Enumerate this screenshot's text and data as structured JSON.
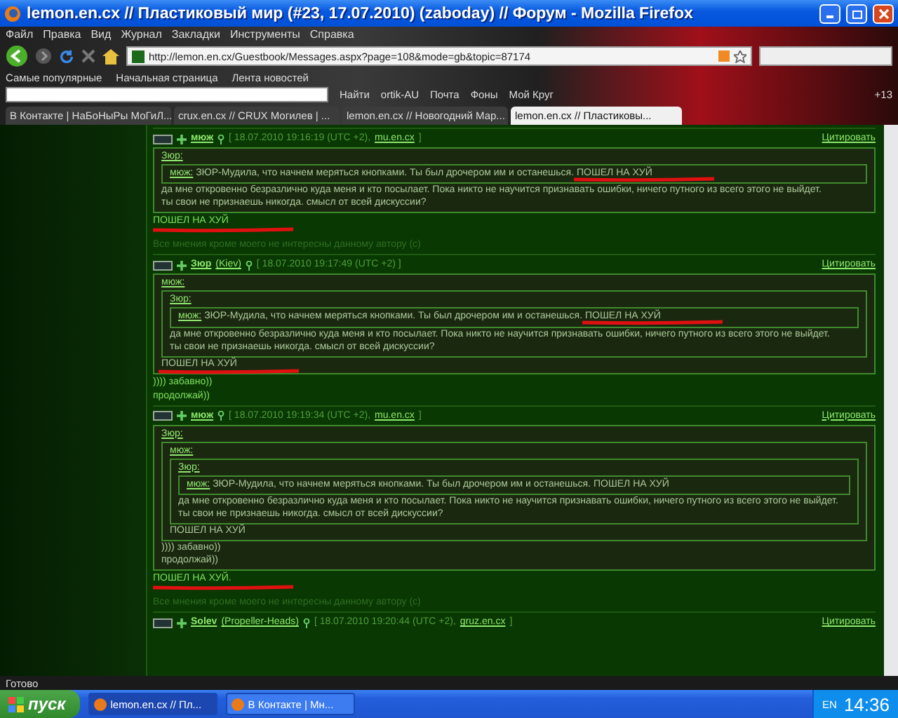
{
  "window": {
    "title": "lemon.en.cx // Пластиковый мир (#23, 17.07.2010) (zaboday) // Форум - Mozilla Firefox"
  },
  "menu": [
    "Файл",
    "Правка",
    "Вид",
    "Журнал",
    "Закладки",
    "Инструменты",
    "Справка"
  ],
  "address": {
    "value": "http://lemon.en.cx/Guestbook/Messages.aspx?page=108&mode=gb&topic=87174"
  },
  "bookmarks": [
    "Самые популярные",
    "Начальная страница",
    "Лента новостей"
  ],
  "yandex_bar": {
    "find_button": "Найти",
    "items": [
      "ortik-AU",
      "Почта",
      "Фоны",
      "Мой Круг"
    ],
    "counter": "+13"
  },
  "tabs": [
    {
      "label": "В Контакте | НаБоНыРы МоГиЛ...",
      "selected": false
    },
    {
      "label": "crux.en.cx // CRUX Могилев | ...",
      "selected": false
    },
    {
      "label": "lemon.en.cx // Новогодний Мар...",
      "selected": false
    },
    {
      "label": "lemon.en.cx // Пластиковы...",
      "selected": true
    }
  ],
  "posts": [
    {
      "author": "мюж",
      "date": "[ 18.07.2010 19:16:19 (UTC +2),",
      "link": "mu.en.cx",
      "bracket": "]",
      "quote_action": "Цитировать",
      "quote": {
        "kind": "block",
        "author": "Зюр:",
        "quote": {
          "kind": "inline",
          "author": "мюж:",
          "text": "ЗЮР-Мудила, что начнем меряться кнопками. Ты был дрочером им и останешься.",
          "highlight": {
            "text": "ПОШЕЛ НА ХУЙ",
            "annotated": true
          }
        },
        "lines": [
          {
            "text": "да мне откровенно безразлично куда меня и кто посылает. Пока никто не научится признавать ошибки, ничего путного из всего этого не выйдет.",
            "annotated": false
          },
          {
            "text": "ты свои не признаешь никогда. смысл от всей дискуссии?",
            "annotated": false
          }
        ]
      },
      "reply": [
        {
          "text": "ПОШЕЛ НА ХУЙ",
          "annotated": true
        }
      ],
      "signature": "Все мнения кроме моего не интересны данному автору (с)"
    },
    {
      "author": "Зюр",
      "city": "(Kiev)",
      "date": "[ 18.07.2010 19:17:49 (UTC +2) ]",
      "quote_action": "Цитировать",
      "quote": {
        "kind": "block",
        "author": "мюж:",
        "quote": {
          "kind": "block",
          "author": "Зюр:",
          "quote": {
            "kind": "inline",
            "author": "мюж:",
            "text": "ЗЮР-Мудила, что начнем меряться кнопками. Ты был дрочером им и останешься.",
            "highlight": {
              "text": "ПОШЕЛ НА ХУЙ",
              "annotated": true
            }
          },
          "lines": [
            {
              "text": "да мне откровенно безразлично куда меня и кто посылает. Пока никто не научится признавать ошибки, ничего путного из всего этого не выйдет.",
              "annotated": false
            },
            {
              "text": "ты свои не признаешь никогда. смысл от всей дискуссии?",
              "annotated": false
            }
          ]
        },
        "lines": [
          {
            "text": "ПОШЕЛ НА ХУЙ",
            "annotated": true
          }
        ]
      },
      "reply": [
        {
          "text": ")))) забавно))",
          "annotated": false
        },
        {
          "text": "продолжай))",
          "annotated": false
        }
      ]
    },
    {
      "author": "мюж",
      "date": "[ 18.07.2010 19:19:34 (UTC +2),",
      "link": "mu.en.cx",
      "bracket": "]",
      "quote_action": "Цитировать",
      "quote": {
        "kind": "block",
        "author": "Зюр:",
        "quote": {
          "kind": "block",
          "author": "мюж:",
          "quote": {
            "kind": "block",
            "author": "Зюр:",
            "quote": {
              "kind": "inline",
              "author": "мюж:",
              "text": "ЗЮР-Мудила, что начнем меряться кнопками. Ты был дрочером им и останешься.",
              "highlight": {
                "text": "ПОШЕЛ НА ХУЙ",
                "annotated": false
              }
            },
            "lines": [
              {
                "text": "да мне откровенно безразлично куда меня и кто посылает. Пока никто не научится признавать ошибки, ничего путного из всего этого не выйдет.",
                "annotated": false
              },
              {
                "text": "ты свои не признаешь никогда. смысл от всей дискуссии?",
                "annotated": false
              }
            ]
          },
          "lines": [
            {
              "text": "ПОШЕЛ НА ХУЙ",
              "annotated": false
            }
          ]
        },
        "lines": [
          {
            "text": ")))) забавно))",
            "annotated": false
          },
          {
            "text": "продолжай))",
            "annotated": false
          }
        ]
      },
      "reply": [
        {
          "text": "ПОШЕЛ НА ХУЙ.",
          "annotated": true
        }
      ],
      "signature": "Все мнения кроме моего не интересны данному автору (с)"
    },
    {
      "author": "Solev",
      "city": "(Propeller-Heads)",
      "date": "[ 18.07.2010 19:20:44 (UTC +2),",
      "link": "gruz.en.cx",
      "bracket": "]",
      "quote_action": "Цитировать"
    }
  ],
  "status_bar": {
    "text": "Готово"
  },
  "taskbar": {
    "start": "пуск",
    "tasks": [
      {
        "label": "lemon.en.cx // Пл...",
        "selected": true
      },
      {
        "label": "В Контакте | Мн...",
        "selected": false
      }
    ],
    "language": "EN",
    "clock": "14:36"
  }
}
